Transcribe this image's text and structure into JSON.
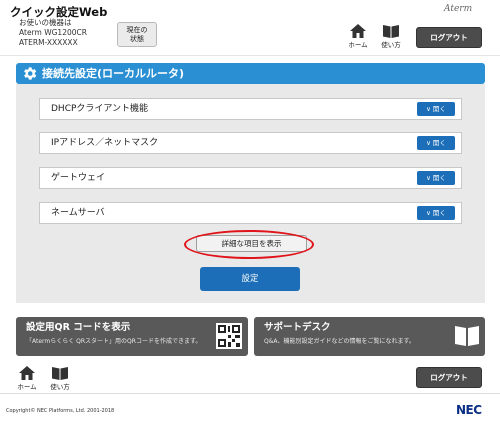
{
  "header": {
    "app_title": "クイック設定Web",
    "device_label": "お使いの機器は",
    "device_model": "Aterm WG1200CR",
    "device_id": "ATERM-XXXXXX",
    "status_button": [
      "現在の",
      "状態"
    ],
    "brand": "Aterm",
    "home_label": "ホーム",
    "guide_label": "使い方",
    "logout_label": "ログアウト"
  },
  "section": {
    "title": "接続先設定(ローカルルータ)",
    "items": [
      {
        "label": "DHCPクライアント機能",
        "open_label": "開く"
      },
      {
        "label": "IPアドレス／ネットマスク",
        "open_label": "開く"
      },
      {
        "label": "ゲートウェイ",
        "open_label": "開く"
      },
      {
        "label": "ネームサーバ",
        "open_label": "開く"
      }
    ],
    "detail_button": "詳細な項目を表示",
    "set_button": "設定"
  },
  "cards": {
    "qr": {
      "title": "設定用QR コードを表示",
      "desc": "「Atermらくらく QRスタート」用のQRコードを作成できます。"
    },
    "support": {
      "title": "サポートデスク",
      "desc": "Q&A、機能別設定ガイドなどの情報をご覧になれます。"
    }
  },
  "footer": {
    "home_label": "ホーム",
    "guide_label": "使い方",
    "logout_label": "ログアウト",
    "copyright": "Copyright© NEC Platforms, Ltd. 2001-2018",
    "company_logo": "NEC"
  },
  "colors": {
    "accent": "#2a8fd3",
    "button_blue": "#1d6eb8",
    "dark_button": "#4c4c4c",
    "highlight_ring": "#e0141b"
  }
}
